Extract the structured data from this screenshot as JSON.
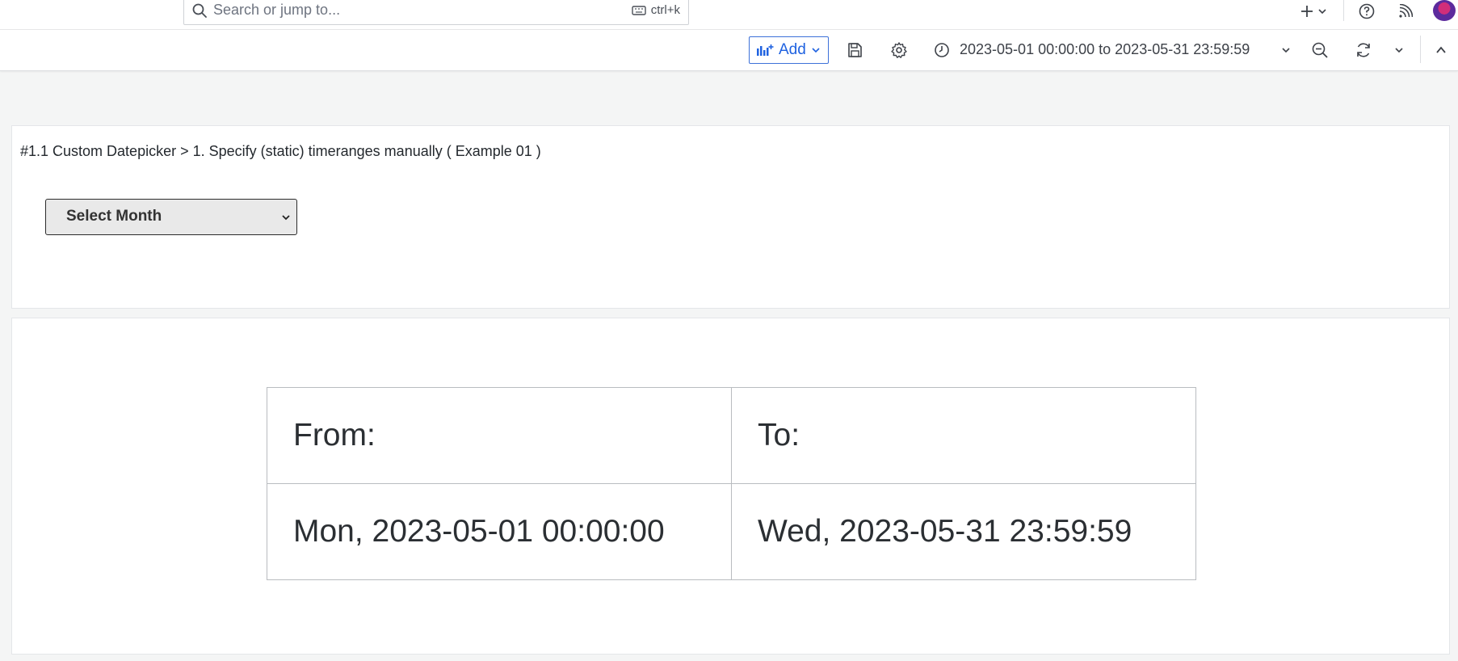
{
  "topbar": {
    "search_placeholder": "Search or jump to...",
    "search_shortcut": "ctrl+k",
    "icons": [
      "search-icon",
      "keyboard-icon",
      "plus-icon",
      "chevron-down-icon",
      "help-icon",
      "rss-icon",
      "avatar"
    ]
  },
  "toolbar": {
    "add_label": "Add",
    "time_range": "2023-05-01 00:00:00 to 2023-05-31 23:59:59",
    "accent_color": "#1f62e0"
  },
  "panel1": {
    "title": "#1.1 Custom Datepicker > 1. Specify (static) timeranges manually ( Example 01 )",
    "select_value": "Select Month"
  },
  "panel2": {
    "from_label": "From:",
    "to_label": "To:",
    "from_value": "Mon, 2023-05-01 00:00:00",
    "to_value": "Wed, 2023-05-31 23:59:59"
  }
}
